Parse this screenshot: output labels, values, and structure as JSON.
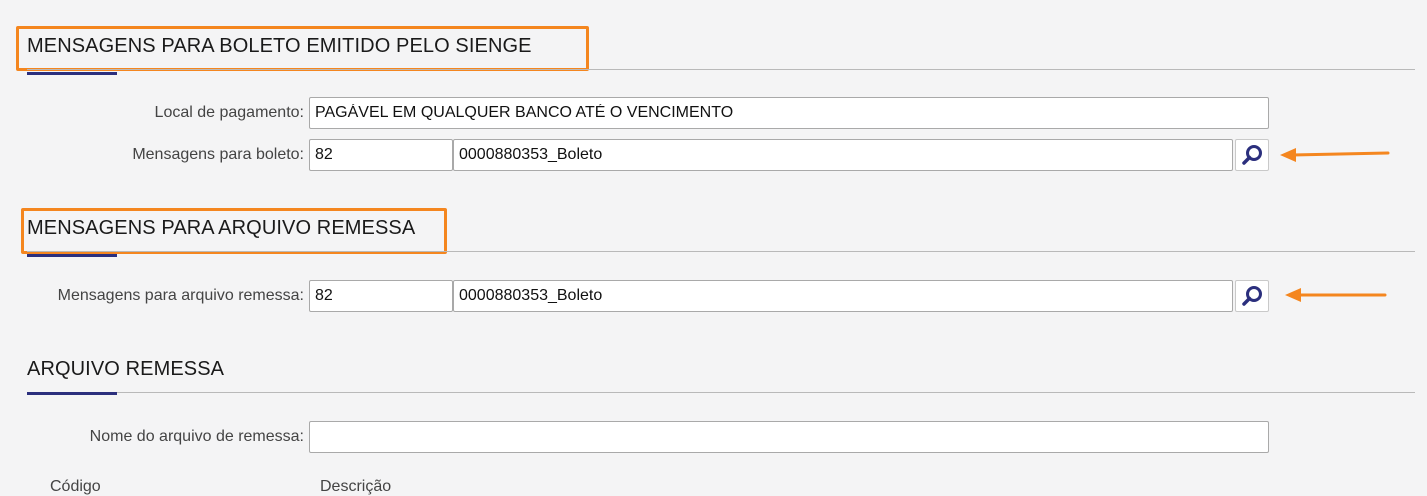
{
  "sections": {
    "boleto": {
      "title": "MENSAGENS PARA BOLETO EMITIDO PELO SIENGE"
    },
    "remessa_msg": {
      "title": "MENSAGENS PARA ARQUIVO REMESSA"
    },
    "arquivo": {
      "title": "ARQUIVO REMESSA"
    }
  },
  "fields": {
    "local_pagamento": {
      "label": "Local de pagamento:",
      "value": "PAGÁVEL EM QUALQUER BANCO ATÉ O VENCIMENTO"
    },
    "mensagens_boleto": {
      "label": "Mensagens para boleto:",
      "code": "82",
      "description": "0000880353_Boleto"
    },
    "mensagens_remessa": {
      "label": "Mensagens para arquivo remessa:",
      "code": "82",
      "description": "0000880353_Boleto"
    },
    "nome_arquivo": {
      "label": "Nome do arquivo de remessa:",
      "value": ""
    }
  },
  "table_headers_partial": {
    "col1": "Código",
    "col2": "Descrição"
  },
  "icons": {
    "lookup": "search-icon",
    "annotation": "arrow-left-icon"
  },
  "colors": {
    "highlight": "#f4861f",
    "accent": "#2b2f7d",
    "icon": "#2b2f7d"
  }
}
